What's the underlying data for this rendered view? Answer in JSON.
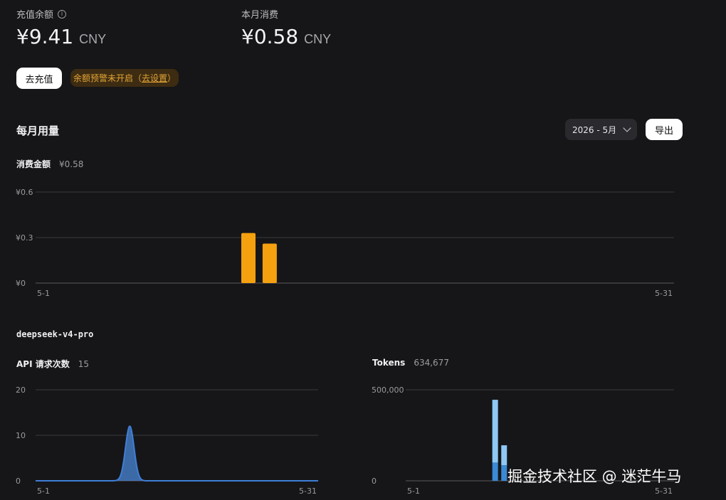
{
  "balance": {
    "label": "充值余额",
    "value": "¥9.41",
    "currency": "CNY"
  },
  "monthly_spend": {
    "label": "本月消费",
    "value": "¥0.58",
    "currency": "CNY"
  },
  "actions": {
    "recharge_label": "去充值",
    "alert_text": "余额预警未开启（",
    "alert_link": "去设置",
    "alert_close": "）"
  },
  "usage": {
    "title": "每月用量",
    "month_selected": "2026 - 5月",
    "export_label": "导出"
  },
  "spend_metric": {
    "label": "消费金额",
    "value": "¥0.58"
  },
  "model": {
    "name": "deepseek-v4-pro"
  },
  "requests_metric": {
    "label": "API 请求次数",
    "value": "15"
  },
  "tokens_metric": {
    "label": "Tokens",
    "value": "634,677"
  },
  "watermark": "掘金技术社区 @ 迷茫牛马",
  "colors": {
    "spend_bar": "#f5a00f",
    "request_area": "#4a87d6",
    "token_light": "#8ec8f5",
    "token_dark": "#3a8ad6"
  },
  "chart_data": [
    {
      "type": "bar",
      "name": "spend",
      "x_range": [
        1,
        31
      ],
      "x_ticks": [
        "5-1",
        "5-31"
      ],
      "y_ticks": [
        "¥0",
        "¥0.3",
        "¥0.6"
      ],
      "ylim": [
        0,
        0.6
      ],
      "grid": true,
      "points": [
        {
          "day": 11,
          "value": 0.33
        },
        {
          "day": 12,
          "value": 0.26
        }
      ]
    },
    {
      "type": "area",
      "name": "requests",
      "x_range": [
        1,
        31
      ],
      "x_ticks": [
        "5-1",
        "5-31"
      ],
      "y_ticks": [
        "0",
        "10",
        "20"
      ],
      "ylim": [
        0,
        20
      ],
      "grid": true,
      "peak_day": 11,
      "peak_value": 12
    },
    {
      "type": "bar",
      "name": "tokens",
      "x_range": [
        1,
        31
      ],
      "x_ticks": [
        "5-1",
        "5-31"
      ],
      "y_ticks": [
        "0",
        "500,000"
      ],
      "ylim": [
        0,
        500000
      ],
      "grid": true,
      "points": [
        {
          "day": 11,
          "total": 445000,
          "base": 100000
        },
        {
          "day": 12,
          "total": 195000,
          "base": 85000
        }
      ]
    }
  ]
}
